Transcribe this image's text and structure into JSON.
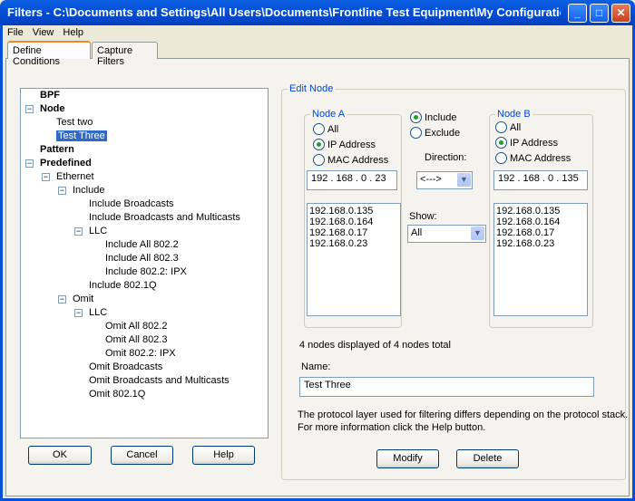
{
  "window": {
    "title": "Filters - C:\\Documents and Settings\\All Users\\Documents\\Frontline Test Equipment\\My Configurations\\default.fi...",
    "minimize": "_",
    "maximize": "□",
    "close": "✕"
  },
  "menu": [
    "File",
    "View",
    "Help"
  ],
  "tabs": [
    "Define Conditions",
    "Capture Filters"
  ],
  "tree": [
    {
      "label": "BPF",
      "level": 0,
      "bold": true,
      "expander": false
    },
    {
      "label": "Node",
      "level": 0,
      "bold": true,
      "expander": true
    },
    {
      "label": "Test two",
      "level": 1,
      "bold": false,
      "expander": false
    },
    {
      "label": "Test Three",
      "level": 1,
      "bold": false,
      "expander": false,
      "selected": true
    },
    {
      "label": "Pattern",
      "level": 0,
      "bold": true,
      "expander": false
    },
    {
      "label": "Predefined",
      "level": 0,
      "bold": true,
      "expander": true
    },
    {
      "label": "Ethernet",
      "level": 1,
      "bold": false,
      "expander": true
    },
    {
      "label": "Include",
      "level": 2,
      "bold": false,
      "expander": true
    },
    {
      "label": "Include Broadcasts",
      "level": 3,
      "bold": false,
      "expander": false
    },
    {
      "label": "Include Broadcasts and Multicasts",
      "level": 3,
      "bold": false,
      "expander": false
    },
    {
      "label": "LLC",
      "level": 3,
      "bold": false,
      "expander": true
    },
    {
      "label": "Include All 802.2",
      "level": 4,
      "bold": false,
      "expander": false
    },
    {
      "label": "Include All 802.3",
      "level": 4,
      "bold": false,
      "expander": false
    },
    {
      "label": "Include 802.2: IPX",
      "level": 4,
      "bold": false,
      "expander": false
    },
    {
      "label": "Include 802.1Q",
      "level": 3,
      "bold": false,
      "expander": false
    },
    {
      "label": "Omit",
      "level": 2,
      "bold": false,
      "expander": true
    },
    {
      "label": "LLC",
      "level": 3,
      "bold": false,
      "expander": true
    },
    {
      "label": "Omit All 802.2",
      "level": 4,
      "bold": false,
      "expander": false
    },
    {
      "label": "Omit All 802.3",
      "level": 4,
      "bold": false,
      "expander": false
    },
    {
      "label": "Omit 802.2: IPX",
      "level": 4,
      "bold": false,
      "expander": false
    },
    {
      "label": "Omit Broadcasts",
      "level": 3,
      "bold": false,
      "expander": false
    },
    {
      "label": "Omit Broadcasts and Multicasts",
      "level": 3,
      "bold": false,
      "expander": false
    },
    {
      "label": "Omit 802.1Q",
      "level": 3,
      "bold": false,
      "expander": false
    }
  ],
  "buttons": {
    "ok": "OK",
    "cancel": "Cancel",
    "help": "Help",
    "modify": "Modify",
    "delete": "Delete"
  },
  "edit_node": {
    "legend": "Edit Node",
    "node_a": {
      "legend": "Node A",
      "options": [
        "All",
        "IP Address",
        "MAC Address"
      ],
      "selected": 1,
      "address": "192 . 168 .  0  .  23",
      "list": [
        "192.168.0.135",
        "192.168.0.164",
        "192.168.0.17",
        "192.168.0.23"
      ]
    },
    "node_b": {
      "legend": "Node B",
      "options": [
        "All",
        "IP Address",
        "MAC Address"
      ],
      "selected": 1,
      "address": "192 . 168 .  0  . 135",
      "list": [
        "192.168.0.135",
        "192.168.0.164",
        "192.168.0.17",
        "192.168.0.23"
      ]
    },
    "mode": {
      "options": [
        "Include",
        "Exclude"
      ],
      "selected": 0
    },
    "direction_label": "Direction:",
    "direction_value": "<--->",
    "show_label": "Show:",
    "show_value": "All",
    "count_text": "4 nodes displayed of 4 nodes total",
    "name_label": "Name:",
    "name_value": "Test Three",
    "info_line1": "The protocol layer used for filtering differs depending on the protocol stack.",
    "info_line2": "For more information click the Help button."
  }
}
